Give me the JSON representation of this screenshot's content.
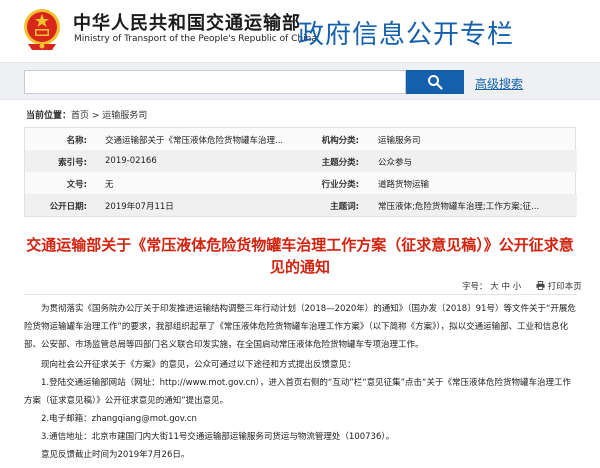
{
  "header": {
    "ministry_cn": "中华人民共和国交通运输部",
    "ministry_en": "Ministry of Transport of the People's Republic of China",
    "column_title": "政府信息公开专栏"
  },
  "search": {
    "placeholder": "",
    "button_icon": "search-icon",
    "advanced_label": "高级搜索"
  },
  "breadcrumb": {
    "label": "当前位置：",
    "home": "首页",
    "separator": " > ",
    "current": "运输服务司"
  },
  "metadata": [
    {
      "k1": "名称:",
      "v1": "交通运输部关于《常压液体危险货物罐车治理...",
      "k2": "机构分类:",
      "v2": "运输服务司"
    },
    {
      "k1": "索引号:",
      "v1": "2019-02166",
      "k2": "主题分类:",
      "v2": "公众参与"
    },
    {
      "k1": "文号:",
      "v1": "无",
      "k2": "行业分类:",
      "v2": "道路货物运输"
    },
    {
      "k1": "公开日期:",
      "v1": "2019年07月11日",
      "k2": "主题词:",
      "v2": "常压液体;危险货物罐车治理;工作方案;征..."
    }
  ],
  "document": {
    "title": "交通运输部关于《常压液体危险货物罐车治理工作方案（征求意见稿）》公开征求意见的通知",
    "font_label": "字号：",
    "font_large": "大",
    "font_medium": "中",
    "font_small": "小",
    "print_label": "打印本页",
    "paragraphs": [
      "　　为贯彻落实《国务院办公厅关于印发推进运输结构调整三年行动计划（2018—2020年）的通知》（国办发〔2018〕91号）等文件关于“开展危险货物运输罐车治理工作”的要求，我部组织起草了《常压液体危险货物罐车治理工作方案》（以下简称《方案》），拟以交通运输部、工业和信息化部、公安部、市场监管总局等四部门名义联合印发实施，在全国启动常压液体危险货物罐车专项治理工作。",
      "　　现向社会公开征求关于《方案》的意见，公众可通过以下途径和方式提出反馈意见：",
      "　　1.登陆交通运输部网站（网址：http://www.mot.gov.cn），进入首页右侧的“互动”栏“意见征集”点击“关于《常压液体危险货物罐车治理工作方案（征求意见稿）》公开征求意见的通知”提出意见。",
      "　　2.电子邮箱：zhangqiang@mot.gov.cn",
      "　　3.通信地址：北京市建国门内大街11号交通运输部运输服务司货运与物流管理处（100736）。",
      "　　意见反馈截止时间为2019年7月26日。"
    ]
  },
  "colors": {
    "brand_blue": "#1560ad",
    "title_red": "#d2230f",
    "emblem_red": "#d8261c",
    "emblem_gold": "#f2c12e"
  }
}
